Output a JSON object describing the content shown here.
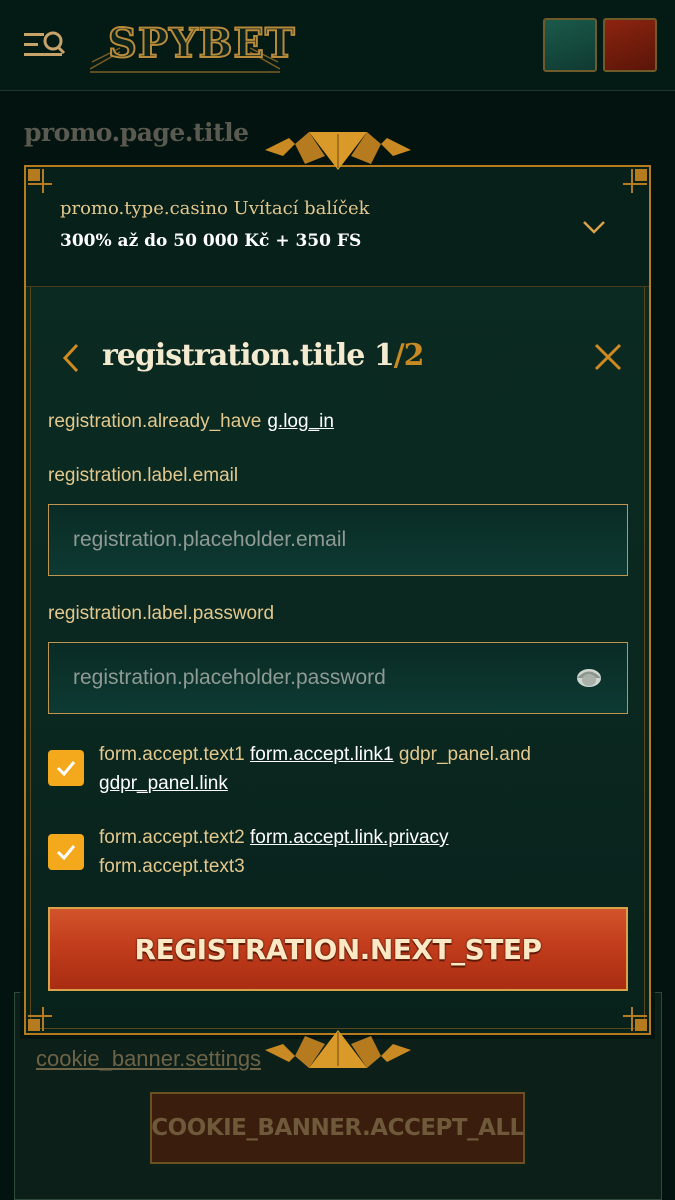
{
  "header": {
    "logo_text": "SPYBET",
    "left_button_color": "#1b5a4b",
    "right_button_color": "#8c2410"
  },
  "page": {
    "title": "promo.page.title"
  },
  "cookie_banner": {
    "settings_label": "cookie_banner.settings",
    "accept_all_label": "COOKIE_BANNER.ACCEPT_ALL"
  },
  "promo": {
    "type_label": "promo.type.casino Uvítací balíček",
    "offer": "300% až do 50 000 Kč + 350 FS"
  },
  "registration": {
    "title": "registration.title",
    "step_current": "1",
    "step_total": "/2",
    "already_have": "registration.already_have",
    "log_in_link": "g.log_in",
    "email_label": "registration.label.email",
    "email_placeholder": "registration.placeholder.email",
    "password_label": "registration.label.password",
    "password_placeholder": "registration.placeholder.password",
    "consent1": {
      "checked": true,
      "text1": "form.accept.text1",
      "link1": "form.accept.link1",
      "and": "gdpr_panel.and",
      "gdpr_link": "gdpr_panel.link"
    },
    "consent2": {
      "checked": true,
      "text2": "form.accept.text2",
      "privacy_link": "form.accept.link.privacy",
      "text3": "form.accept.text3"
    },
    "next_button": "REGISTRATION.NEXT_STEP"
  },
  "colors": {
    "accent_gold": "#c98a24",
    "checkbox": "#f4a81c",
    "primary_button": "#c23d1c"
  }
}
